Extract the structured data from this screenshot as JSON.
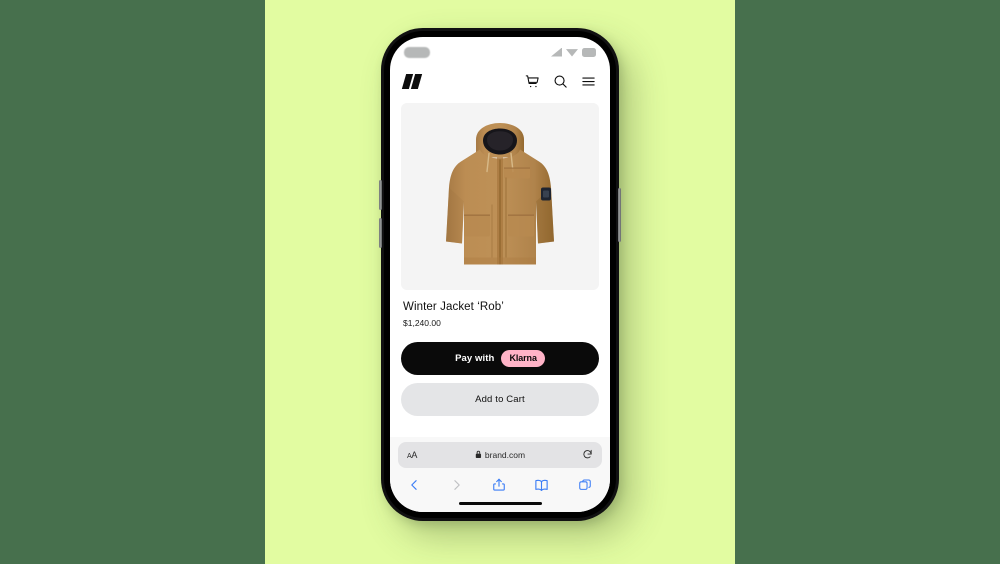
{
  "scene": {
    "background_side_color": "#47704D",
    "background_center_color": "#E2FCA1",
    "device": "iphone-mockup"
  },
  "status_bar": {
    "time_placeholder": "",
    "icons": [
      "signal-icon",
      "wifi-icon",
      "battery-icon"
    ]
  },
  "site_header": {
    "logo_name": "brand-logo",
    "icons": [
      {
        "name": "cart-icon",
        "label": "Cart"
      },
      {
        "name": "search-icon",
        "label": "Search"
      },
      {
        "name": "menu-icon",
        "label": "Menu"
      }
    ]
  },
  "product": {
    "image_alt": "Winter parka jacket in camel tan with black hood lining",
    "title": "Winter Jacket ‘Rob’",
    "price": "$1,240.00"
  },
  "actions": {
    "klarna_pay_label": "Pay with",
    "klarna_brand": "Klarna",
    "klarna_brand_color": "#FFB3C7",
    "klarna_button_color": "#0A0A0A",
    "add_to_cart_label": "Add to Cart",
    "add_to_cart_color": "#E4E5E7"
  },
  "browser": {
    "text_size_label": "ᴀA",
    "lock_icon": "lock-icon",
    "url": "brand.com",
    "reload_icon": "reload-icon",
    "toolbar": [
      {
        "name": "back-button",
        "icon": "chevron-left-icon",
        "enabled": true
      },
      {
        "name": "forward-button",
        "icon": "chevron-right-icon",
        "enabled": false
      },
      {
        "name": "share-button",
        "icon": "share-icon",
        "enabled": true
      },
      {
        "name": "bookmarks-button",
        "icon": "book-icon",
        "enabled": true
      },
      {
        "name": "tabs-button",
        "icon": "tabs-icon",
        "enabled": true
      }
    ]
  }
}
